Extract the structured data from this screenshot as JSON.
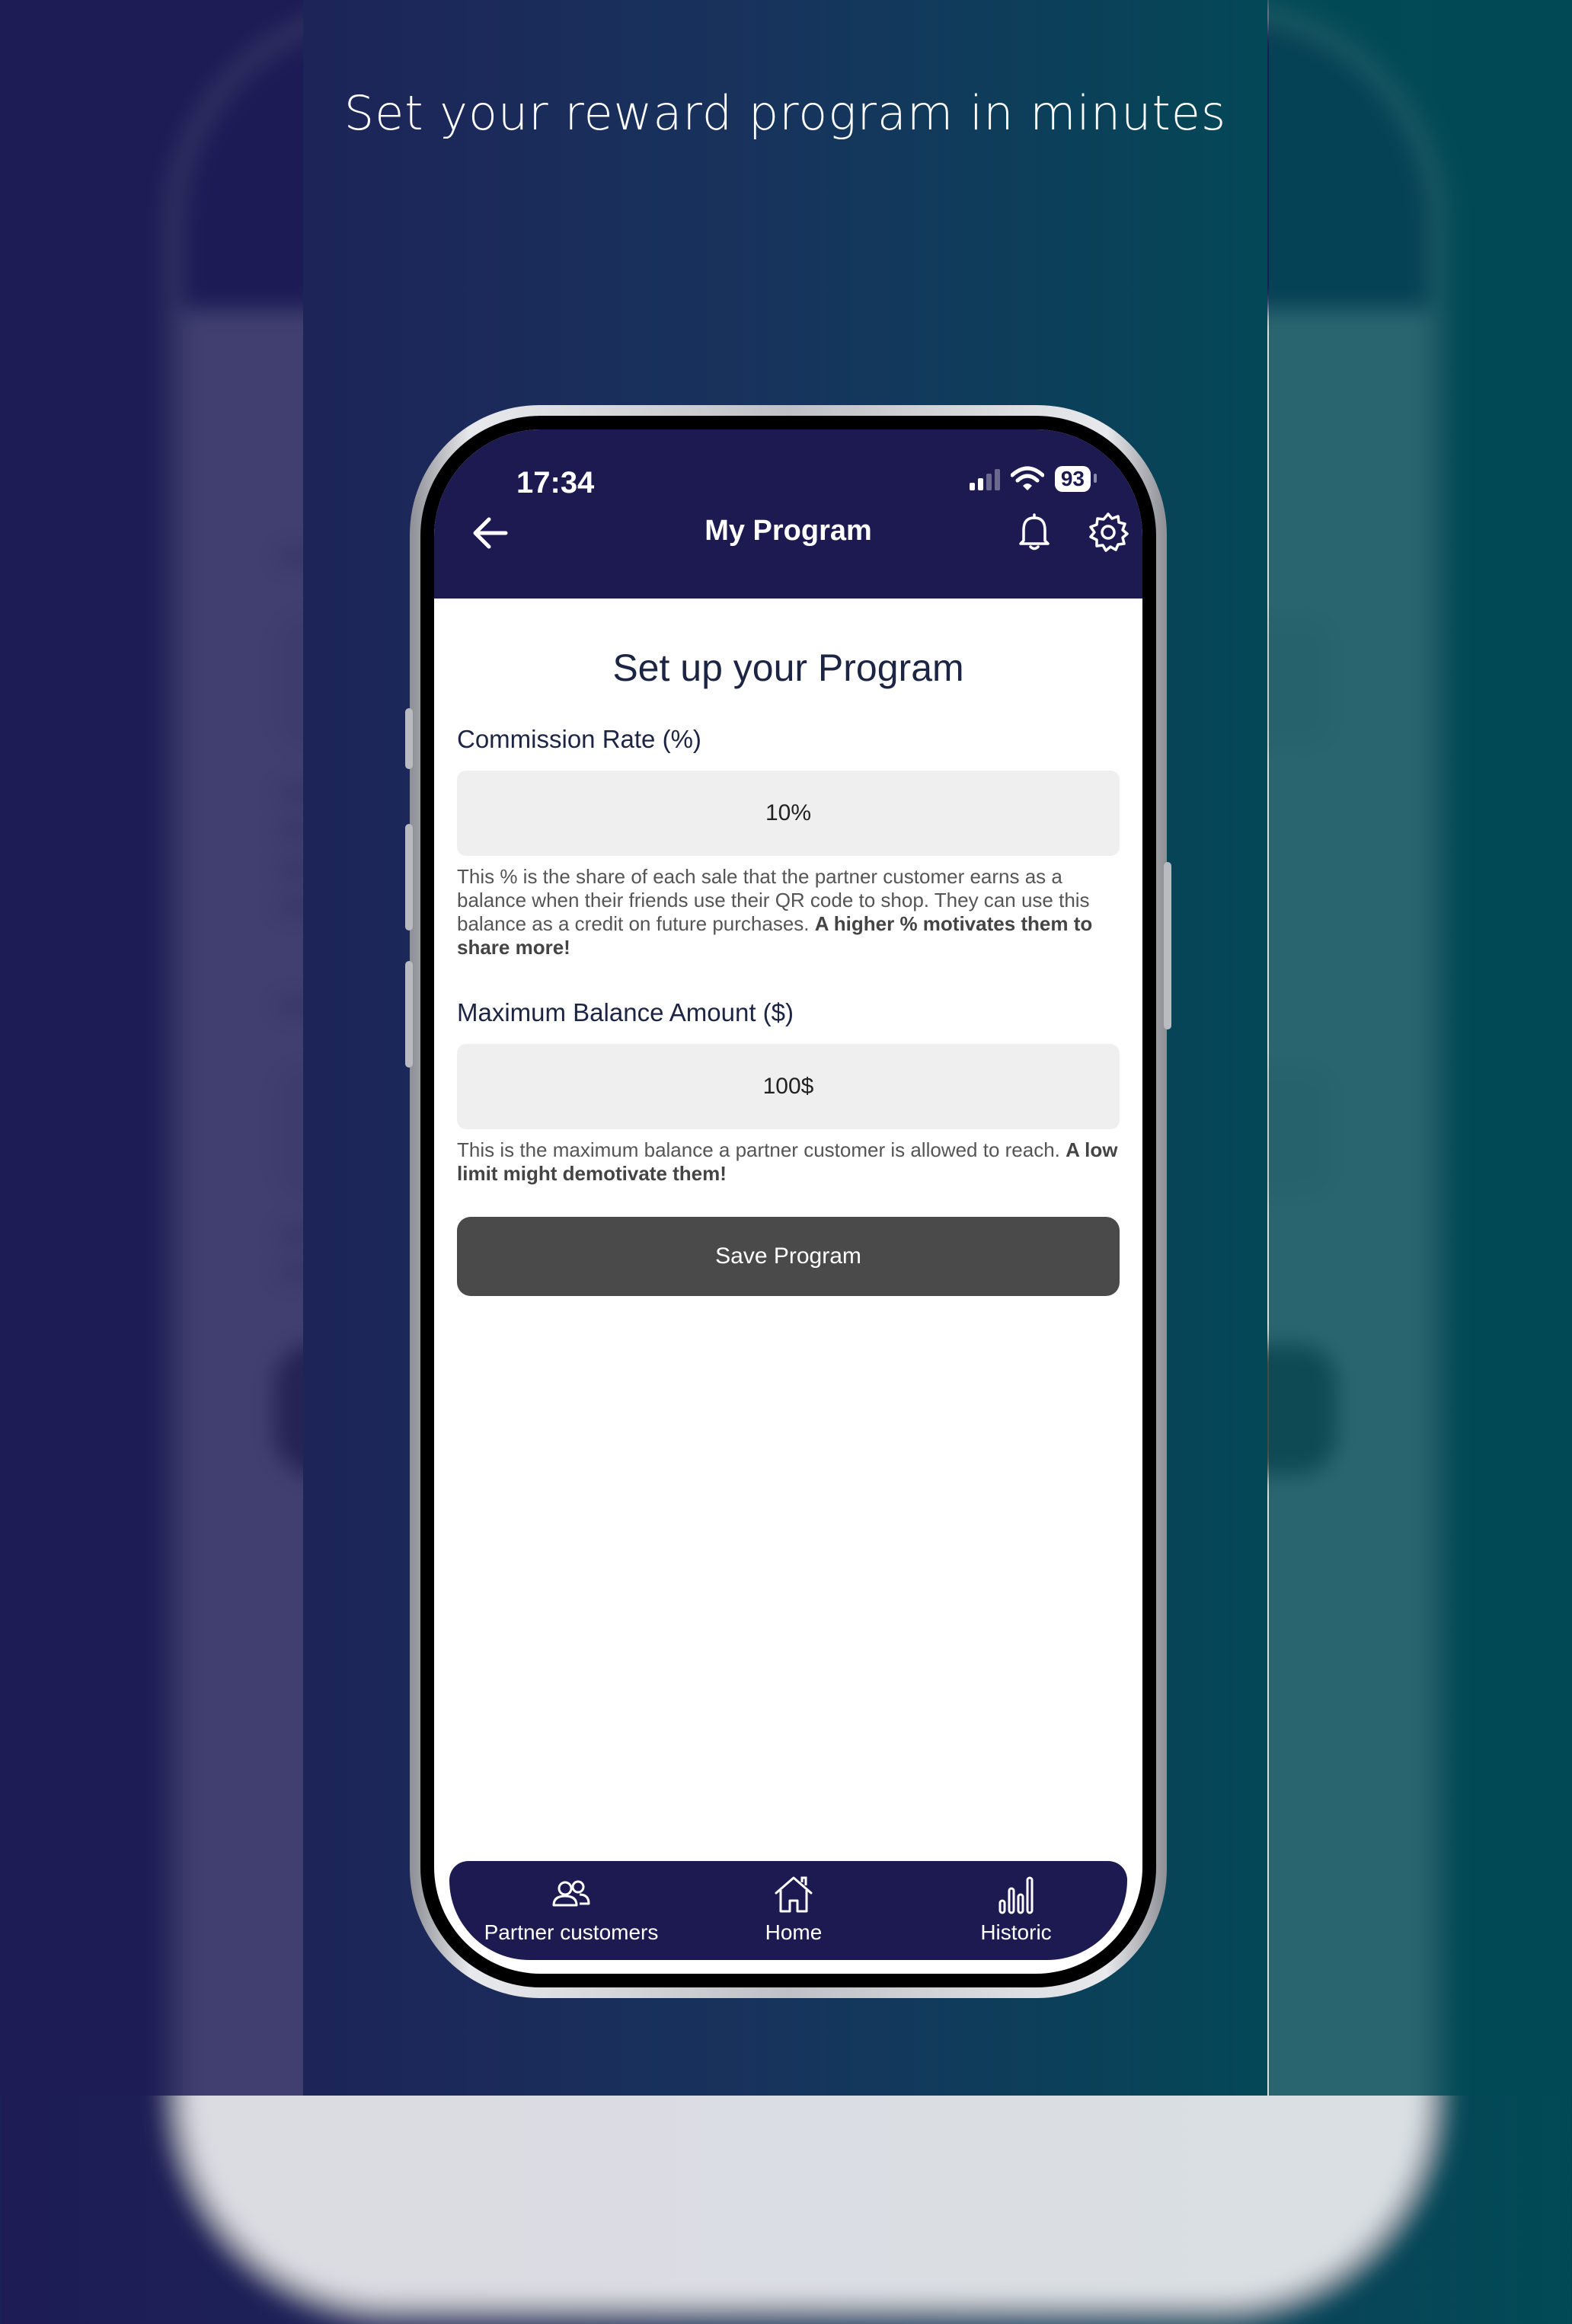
{
  "headline": "Set your reward program in minutes",
  "status": {
    "time": "17:34",
    "battery": "93"
  },
  "nav": {
    "title": "My Program"
  },
  "page": {
    "title": "Set up your Program"
  },
  "commission": {
    "label": "Commission Rate (%)",
    "value": "10%",
    "help_text": "This % is the share of each sale that the partner customer earns as a balance when their friends use their QR code to shop. They can use this balance as a credit on future purchases. ",
    "help_bold": "A higher % motivates them to share more!"
  },
  "max_balance": {
    "label": "Maximum Balance Amount ($)",
    "value": "100$",
    "help_text": "This is the maximum balance a partner customer is allowed to reach. ",
    "help_bold": "A low limit might demotivate them!"
  },
  "save_label": "Save Program",
  "tabs": [
    {
      "label": "Partner customers",
      "icon": "users-icon"
    },
    {
      "label": "Home",
      "icon": "home-icon"
    },
    {
      "label": "Historic",
      "icon": "bar-chart-icon"
    }
  ],
  "colors": {
    "brand_dark": "#1d1a52",
    "button": "#4a4a4a",
    "input_bg": "#efefef"
  }
}
